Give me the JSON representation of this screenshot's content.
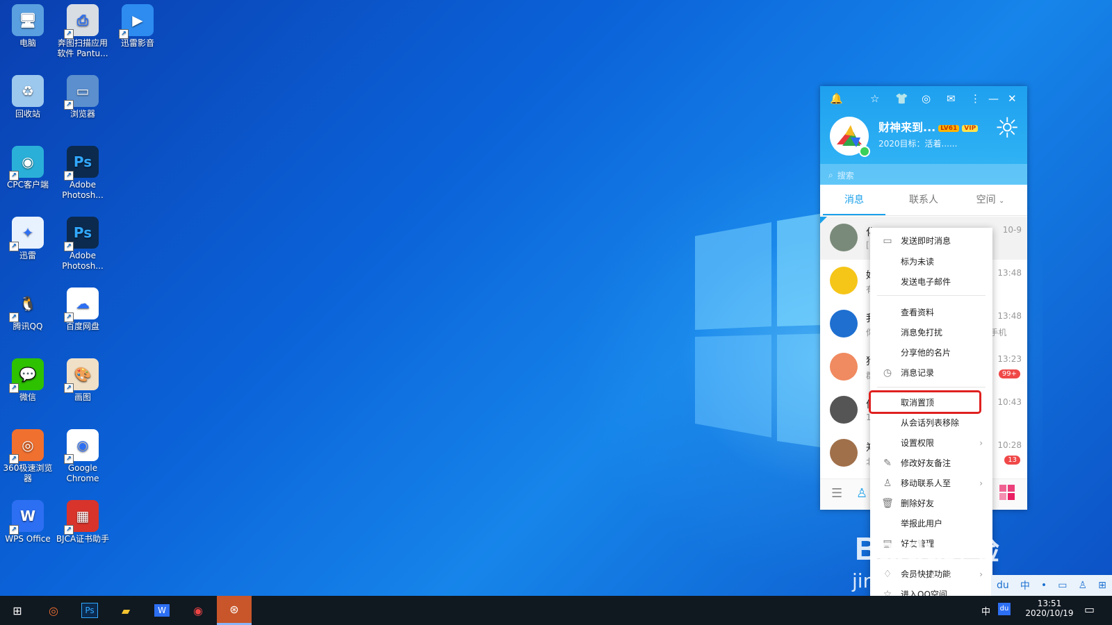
{
  "desktop": {
    "icons": [
      {
        "label": "电脑",
        "glyph": "🖥",
        "bg": "#5aa0e0"
      },
      {
        "label": "奔图扫描应用软件 Pantu...",
        "glyph": "⎙",
        "bg": "#d8dde4"
      },
      {
        "label": "迅雷影音",
        "glyph": "▶",
        "bg": "#2e8cf0"
      },
      {
        "label": "回收站",
        "glyph": "♻",
        "bg": "#9cc8ee"
      },
      {
        "label": "浏览器",
        "glyph": "▭",
        "bg": "#5b8fce"
      },
      {
        "label": "CPC客户端",
        "glyph": "◉",
        "bg": "#2ab0d8"
      },
      {
        "label": "Adobe Photosh...",
        "glyph": "Ps",
        "bg": "#0b2a4e"
      },
      {
        "label": "迅雷",
        "glyph": "✦",
        "bg": "#e8f2ff"
      },
      {
        "label": "Adobe Photosh...",
        "glyph": "Ps",
        "bg": "#0b2a4e"
      },
      {
        "label": "腾讯QQ",
        "glyph": "🐧",
        "bg": "transparent"
      },
      {
        "label": "百度网盘",
        "glyph": "☁",
        "bg": "#ffffff"
      },
      {
        "label": "微信",
        "glyph": "💬",
        "bg": "#2dc100"
      },
      {
        "label": "画图",
        "glyph": "🎨",
        "bg": "#f0e0c8"
      },
      {
        "label": "360极速浏览器",
        "glyph": "◎",
        "bg": "#f07030"
      },
      {
        "label": "Google Chrome",
        "glyph": "◉",
        "bg": "#ffffff"
      },
      {
        "label": "WPS Office",
        "glyph": "W",
        "bg": "#2d6ff2"
      },
      {
        "label": "BJCA证书助手",
        "glyph": "▦",
        "bg": "#d8342c"
      }
    ]
  },
  "qq": {
    "nickname": "财神来到...",
    "level_badge": "LV61",
    "vip_badge": "VIP",
    "signature": "2020目标：活着......",
    "search_placeholder": "搜索",
    "tabs": [
      "消息",
      "联系人",
      "空间"
    ],
    "conversations": [
      {
        "name": "化",
        "preview": "[",
        "time": "10-9",
        "count": "",
        "avatar_color": "#7a8a7a"
      },
      {
        "name": "好友动态",
        "preview": "有新动态",
        "time": "13:48",
        "count": "",
        "avatar_color": "#f5c518"
      },
      {
        "name": "我的Android手机",
        "preview": "你已在Android手机上发送文件到手机",
        "time": "13:48",
        "count": "",
        "avatar_color": "#1e6fd0"
      },
      {
        "name": "狗头的家",
        "preview": "群",
        "time": "13:23",
        "count": "99+",
        "avatar_color": "#f08a60"
      },
      {
        "name": "何证件",
        "preview": "1",
        "time": "10:43",
        "count": "",
        "avatar_color": "#555"
      },
      {
        "name": "郑州网上服务指导群",
        "preview": "北京",
        "time": "10:28",
        "count": "13",
        "avatar_color": "#a0704a"
      }
    ]
  },
  "menu": {
    "items": [
      {
        "label": "发送即时消息",
        "icon": "chat-icon",
        "glyph": "▭"
      },
      {
        "label": "标为未读",
        "icon": "",
        "glyph": ""
      },
      {
        "label": "发送电子邮件",
        "icon": "",
        "glyph": ""
      },
      {
        "label": "查看资料",
        "icon": "",
        "glyph": ""
      },
      {
        "label": "消息免打扰",
        "icon": "",
        "glyph": ""
      },
      {
        "label": "分享他的名片",
        "icon": "",
        "glyph": ""
      },
      {
        "label": "消息记录",
        "icon": "clock-icon",
        "glyph": "◷"
      },
      {
        "label": "取消置顶",
        "icon": "",
        "glyph": ""
      },
      {
        "label": "从会话列表移除",
        "icon": "",
        "glyph": ""
      },
      {
        "label": "设置权限",
        "icon": "",
        "glyph": ""
      },
      {
        "label": "修改好友备注",
        "icon": "pencil-icon",
        "glyph": "✎"
      },
      {
        "label": "移动联系人至",
        "icon": "person-icon",
        "glyph": "♙"
      },
      {
        "label": "删除好友",
        "icon": "trash-icon",
        "glyph": "🗑"
      },
      {
        "label": "举报此用户",
        "icon": "",
        "glyph": ""
      },
      {
        "label": "好友管理",
        "icon": "manage-icon",
        "glyph": "▤"
      },
      {
        "label": "会员快捷功能",
        "icon": "bell-icon",
        "glyph": "♢"
      },
      {
        "label": "进入QQ空间",
        "icon": "star-icon",
        "glyph": "☆"
      }
    ]
  },
  "taskbar": {
    "time": "13:51",
    "date": "2020/10/19",
    "input_method": "中",
    "tray_icons": [
      "du",
      "中",
      "•",
      "▭",
      "♙",
      "⊞"
    ]
  },
  "watermark": {
    "brand": "Baidu",
    "brand_cn": "经验",
    "url": "jingyan.baidu.com"
  }
}
